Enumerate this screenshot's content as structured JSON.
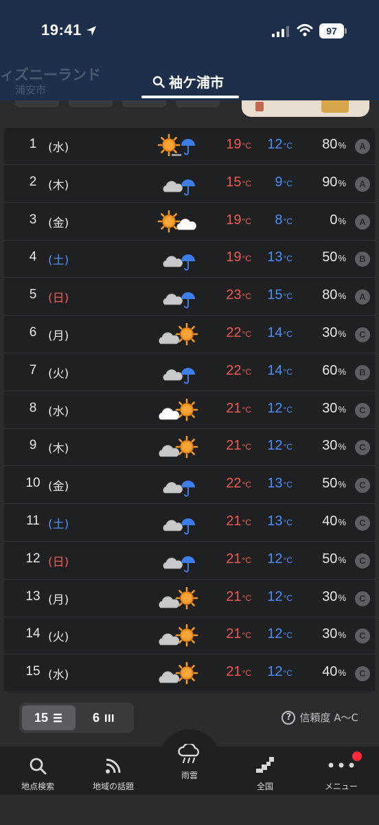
{
  "status_bar": {
    "time": "19:41",
    "battery": "97"
  },
  "header": {
    "faded_location": "ィズニーランド",
    "faded_location_sub": "浦安市",
    "active_location": "袖ケ浦市"
  },
  "forecast": [
    {
      "day": "1",
      "weekday": "(水)",
      "kind": "weekday",
      "icon": "sun-rain",
      "high": "19",
      "low": "12",
      "pop": "80",
      "reliability": "A"
    },
    {
      "day": "2",
      "weekday": "(木)",
      "kind": "weekday",
      "icon": "cloud-rain",
      "high": "15",
      "low": "9",
      "pop": "90",
      "reliability": "A"
    },
    {
      "day": "3",
      "weekday": "(金)",
      "kind": "weekday",
      "icon": "sun-cloud",
      "high": "19",
      "low": "8",
      "pop": "0",
      "reliability": "A"
    },
    {
      "day": "4",
      "weekday": "(土)",
      "kind": "saturday",
      "icon": "cloud-rain",
      "high": "19",
      "low": "13",
      "pop": "50",
      "reliability": "B"
    },
    {
      "day": "5",
      "weekday": "(日)",
      "kind": "sunday",
      "icon": "cloud-rain",
      "high": "23",
      "low": "15",
      "pop": "80",
      "reliability": "A"
    },
    {
      "day": "6",
      "weekday": "(月)",
      "kind": "weekday",
      "icon": "cloud-sun",
      "high": "22",
      "low": "14",
      "pop": "30",
      "reliability": "C"
    },
    {
      "day": "7",
      "weekday": "(火)",
      "kind": "weekday",
      "icon": "cloud-rain",
      "high": "22",
      "low": "14",
      "pop": "60",
      "reliability": "B"
    },
    {
      "day": "8",
      "weekday": "(水)",
      "kind": "weekday",
      "icon": "whitecloud-sun",
      "high": "21",
      "low": "12",
      "pop": "30",
      "reliability": "C"
    },
    {
      "day": "9",
      "weekday": "(木)",
      "kind": "weekday",
      "icon": "cloud-sun",
      "high": "21",
      "low": "12",
      "pop": "30",
      "reliability": "C"
    },
    {
      "day": "10",
      "weekday": "(金)",
      "kind": "weekday",
      "icon": "cloud-rain",
      "high": "22",
      "low": "13",
      "pop": "50",
      "reliability": "C"
    },
    {
      "day": "11",
      "weekday": "(土)",
      "kind": "saturday",
      "icon": "cloud-rain",
      "high": "21",
      "low": "13",
      "pop": "40",
      "reliability": "C"
    },
    {
      "day": "12",
      "weekday": "(日)",
      "kind": "sunday",
      "icon": "cloud-rain",
      "high": "21",
      "low": "12",
      "pop": "50",
      "reliability": "C"
    },
    {
      "day": "13",
      "weekday": "(月)",
      "kind": "weekday",
      "icon": "cloud-sun",
      "high": "21",
      "low": "12",
      "pop": "30",
      "reliability": "C"
    },
    {
      "day": "14",
      "weekday": "(火)",
      "kind": "weekday",
      "icon": "cloud-sun",
      "high": "21",
      "low": "12",
      "pop": "30",
      "reliability": "C"
    },
    {
      "day": "15",
      "weekday": "(水)",
      "kind": "weekday",
      "icon": "cloud-sun",
      "high": "21",
      "low": "12",
      "pop": "40",
      "reliability": "C"
    }
  ],
  "units": {
    "temp": "°C",
    "pop": "%"
  },
  "controls": {
    "view_15": "15",
    "view_6": "6",
    "reliability_label": "信頼度 A〜C"
  },
  "tabbar": [
    {
      "label": "地点検索",
      "icon": "search-icon"
    },
    {
      "label": "地域の話題",
      "icon": "rss-icon"
    },
    {
      "label": "雨雲",
      "icon": "rain-cloud-icon"
    },
    {
      "label": "全国",
      "icon": "japan-map-icon"
    },
    {
      "label": "メニュー",
      "icon": "more-icon"
    }
  ],
  "colors": {
    "high": "#ef5a52",
    "low": "#4d8ef7",
    "header": "#1d2f4a",
    "sun": "#f39a2a",
    "umbrella": "#3f7ee8"
  }
}
